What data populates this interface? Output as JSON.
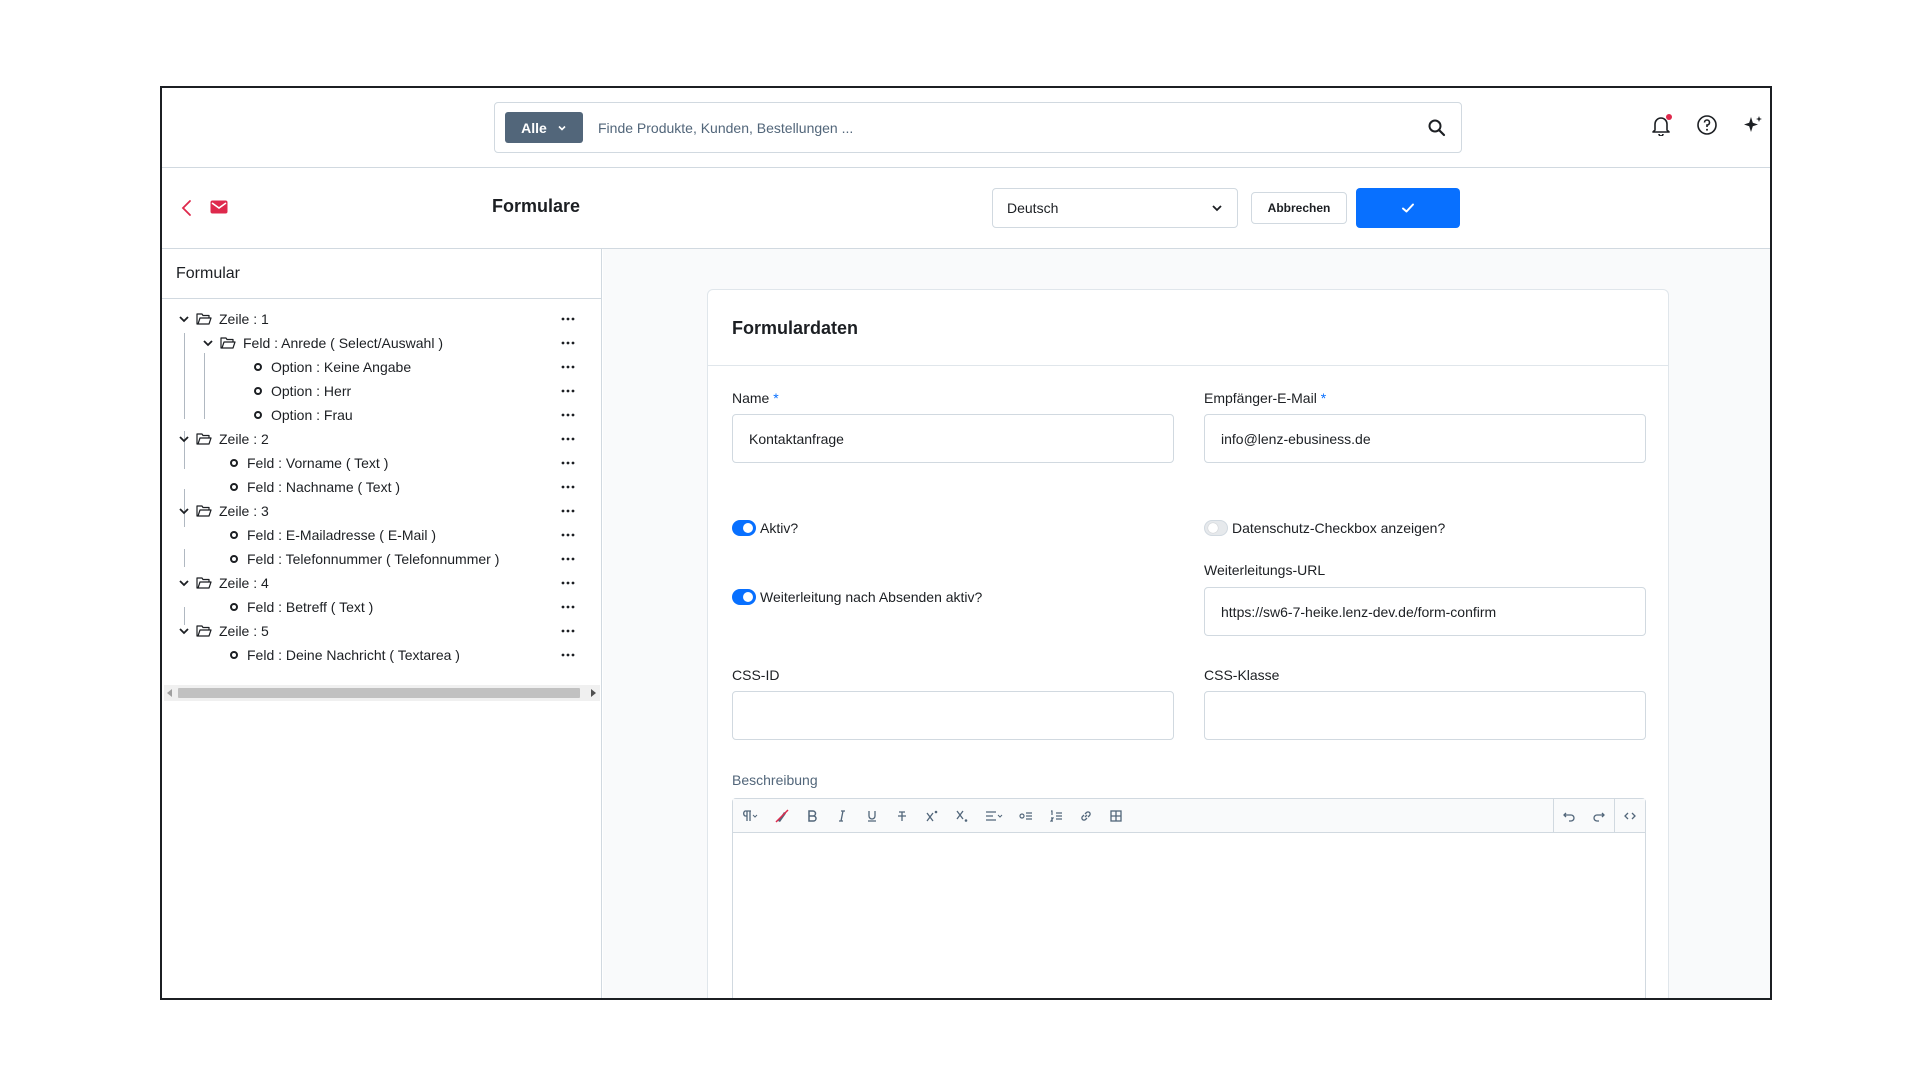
{
  "search": {
    "type_label": "Alle",
    "placeholder": "Finde Produkte, Kunden, Bestellungen ..."
  },
  "header": {
    "title": "Formulare",
    "language": "Deutsch",
    "cancel_label": "Abbrechen"
  },
  "tree": {
    "title": "Formular",
    "rows": [
      "Zeile : 1",
      "Feld : Anrede ( Select/Auswahl )",
      "Option : Keine Angabe",
      "Option : Herr",
      "Option : Frau",
      "Zeile : 2",
      "Feld : Vorname ( Text )",
      "Feld : Nachname ( Text )",
      "Zeile : 3",
      "Feld : E-Mailadresse ( E-Mail )",
      "Feld : Telefonnummer ( Telefonnummer )",
      "Zeile : 4",
      "Feld : Betreff ( Text )",
      "Zeile : 5",
      "Feld : Deine Nachricht ( Textarea )"
    ]
  },
  "form": {
    "card_title": "Formulardaten",
    "name_label": "Name",
    "name_value": "Kontaktanfrage",
    "email_label": "Empfänger-E-Mail",
    "email_value": "info@lenz-ebusiness.de",
    "required_mark": "*",
    "active_label": "Aktiv?",
    "privacy_label": "Datenschutz-Checkbox anzeigen?",
    "redirect_label": "Weiterleitung nach Absenden aktiv?",
    "redirect_url_label": "Weiterleitungs-URL",
    "redirect_url_value": "https://sw6-7-heike.lenz-dev.de/form-confirm",
    "css_id_label": "CSS-ID",
    "css_class_label": "CSS-Klasse",
    "description_label": "Beschreibung"
  },
  "colors": {
    "primary": "#0870ff",
    "brand_red": "#de294c",
    "dark": "#1c1f23",
    "border": "#d1d9e0"
  },
  "icons": [
    "search-icon",
    "bell-icon",
    "help-icon",
    "sparkle-icon",
    "back-icon",
    "envelope-icon",
    "chevron-down-icon",
    "check-icon",
    "folder-open-icon",
    "more-icon"
  ]
}
